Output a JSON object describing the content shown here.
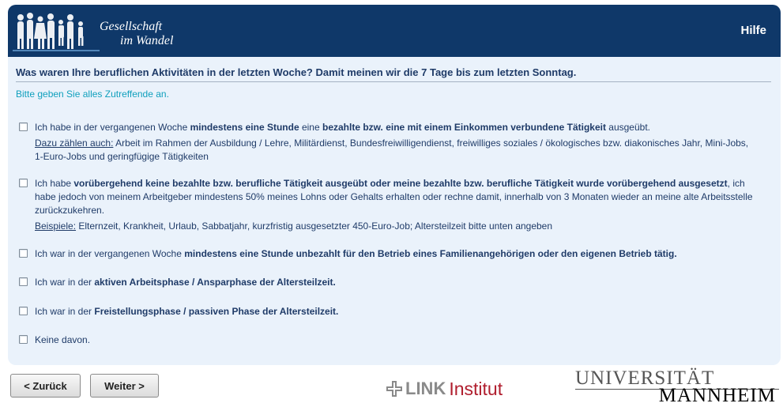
{
  "header": {
    "logo_line1": "Gesellschaft",
    "logo_line2": "im Wandel",
    "help_label": "Hilfe",
    "background_color": "#0f3869"
  },
  "question": "Was waren Ihre beruflichen Aktivitäten in der letzten Woche? Damit meinen wir die 7 Tage bis zum letzten Sonntag.",
  "instruction": "Bitte geben Sie alles Zutreffende an.",
  "options": [
    {
      "checked": false,
      "parts": [
        "Ich habe in der vergangenen Woche ",
        "mindestens eine Stunde",
        " eine ",
        "bezahlte bzw. eine mit einem Einkommen verbundene Tätigkeit",
        " ausgeübt."
      ],
      "sub_label": "Dazu zählen auch:",
      "sub_text": " Arbeit im Rahmen der Ausbildung / Lehre, Militärdienst, Bundesfreiwilligendienst, freiwilliges soziales / ökologisches bzw. diakonisches Jahr, Mini-Jobs, 1-Euro-Jobs und geringfügige Tätigkeiten"
    },
    {
      "checked": false,
      "parts": [
        "Ich habe ",
        "vorübergehend keine bezahlte bzw. berufliche Tätigkeit ausgeübt oder meine bezahlte bzw. berufliche Tätigkeit wurde vorübergehend ausgesetzt",
        ", ich habe jedoch von meinem Arbeitgeber mindestens 50% meines Lohns oder Gehalts erhalten oder rechne damit, innerhalb von 3 Monaten wieder an meine alte Arbeitsstelle zurückzukehren."
      ],
      "sub_label": "Beispiele:",
      "sub_text": " Elternzeit, Krankheit, Urlaub, Sabbatjahr, kurzfristig ausgesetzter 450-Euro-Job; Altersteilzeit bitte unten angeben"
    },
    {
      "checked": false,
      "parts": [
        "Ich war in der vergangenen Woche ",
        "mindestens eine Stunde unbezahlt für den Betrieb eines Familienangehörigen oder den eigenen Betrieb tätig."
      ]
    },
    {
      "checked": false,
      "parts": [
        "Ich war in der ",
        "aktiven Arbeitsphase / Ansparphase der Altersteilzeit."
      ]
    },
    {
      "checked": false,
      "parts": [
        "Ich war in der ",
        "Freistellungsphase / passiven Phase der Altersteilzeit."
      ]
    },
    {
      "checked": false,
      "parts": [
        "Keine davon."
      ]
    }
  ],
  "buttons": {
    "back": "< Zurück",
    "next": "Weiter >"
  },
  "footer": {
    "link_word": "LINK",
    "institut_word": "Institut",
    "uni_line1": "UNIVERSITÄT",
    "uni_line2": "MANNHEIM"
  }
}
